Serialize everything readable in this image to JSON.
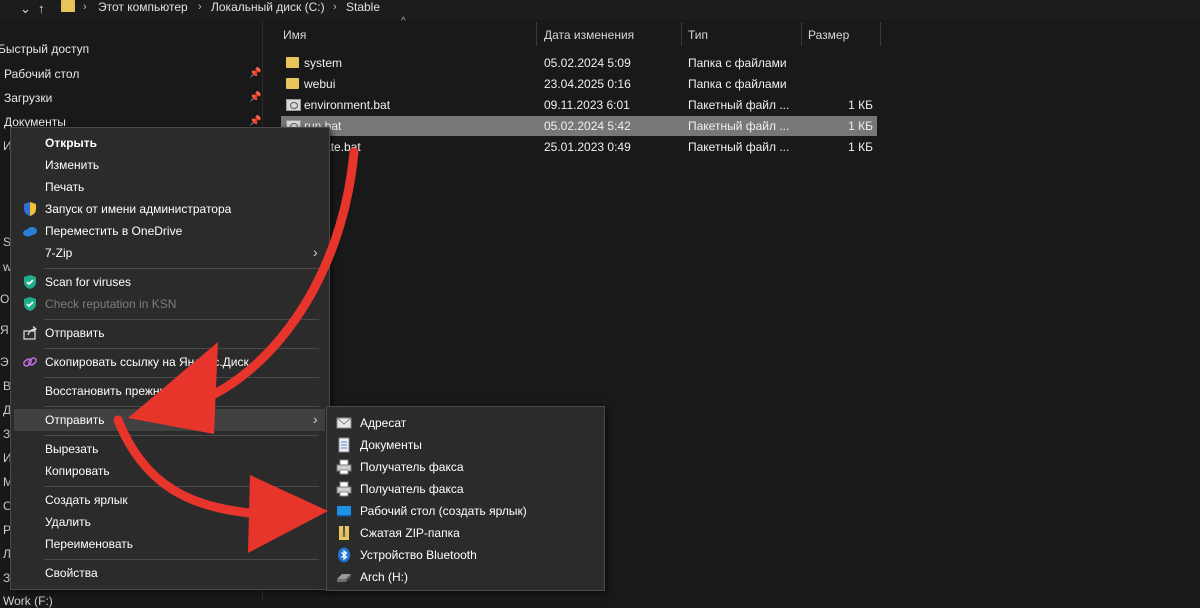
{
  "addressbar": {
    "back_icon": "chevron-down-icon",
    "up_icon": "up-arrow-icon",
    "crumbs": [
      "Этот компьютер",
      "Локальный диск (C:)",
      "Stable"
    ]
  },
  "sidebar": {
    "items": [
      {
        "label": "Быстрый доступ"
      },
      {
        "label": "Рабочий стол",
        "pinned": true
      },
      {
        "label": "Загрузки",
        "pinned": true
      },
      {
        "label": "Документы",
        "pinned": true
      }
    ],
    "fragments": [
      "И",
      "S",
      "w",
      "O",
      "Я",
      "Э",
      "В",
      "Д",
      "З",
      "И",
      "M",
      "O",
      "P",
      "Л",
      "З",
      "Work (F:)"
    ]
  },
  "filelist": {
    "columns": [
      "Имя",
      "Дата изменения",
      "Тип",
      "Размер"
    ],
    "rows": [
      {
        "name": "system",
        "date": "05.02.2024 5:09",
        "type": "Папка с файлами",
        "size": "",
        "icon": "folder-icon"
      },
      {
        "name": "webui",
        "date": "23.04.2025 0:16",
        "type": "Папка с файлами",
        "size": "",
        "icon": "folder-icon"
      },
      {
        "name": "environment.bat",
        "date": "09.11.2023 6:01",
        "type": "Пакетный файл ...",
        "size": "1 КБ",
        "icon": "batch-file-icon"
      },
      {
        "name": "run.bat",
        "date": "05.02.2024 5:42",
        "type": "Пакетный файл ...",
        "size": "1 КБ",
        "icon": "batch-file-icon",
        "selected": true
      },
      {
        "name": "update.bat",
        "date": "25.01.2023 0:49",
        "type": "Пакетный файл ...",
        "size": "1 КБ",
        "icon": "batch-file-icon"
      }
    ]
  },
  "context_menu": {
    "items": [
      {
        "label": "Открыть",
        "bold": true
      },
      {
        "label": "Изменить"
      },
      {
        "label": "Печать"
      },
      {
        "label": "Запуск от имени администратора",
        "icon": "shield-icon"
      },
      {
        "label": "Переместить в OneDrive",
        "icon": "cloud-icon"
      },
      {
        "label": "7-Zip",
        "submenu": true
      },
      {
        "label": "Scan for viruses",
        "icon": "kaspersky-icon"
      },
      {
        "label": "Check reputation in KSN",
        "icon": "kaspersky-icon",
        "disabled": true
      },
      {
        "label": "Отправить",
        "icon": "share-icon"
      },
      {
        "label": "Скопировать ссылку на Яндекс.Диск",
        "icon": "link-icon"
      },
      {
        "label": "Восстановить прежнюю версию"
      },
      {
        "label": "Отправить",
        "submenu": true,
        "highlighted": true
      },
      {
        "label": "Вырезать"
      },
      {
        "label": "Копировать"
      },
      {
        "label": "Создать ярлык"
      },
      {
        "label": "Удалить"
      },
      {
        "label": "Переименовать"
      },
      {
        "label": "Свойства"
      }
    ]
  },
  "send_to_menu": {
    "items": [
      {
        "label": "Адресат",
        "icon": "mail-recipient-icon"
      },
      {
        "label": "Документы",
        "icon": "documents-icon"
      },
      {
        "label": "Получатель факса",
        "icon": "fax-icon"
      },
      {
        "label": "Получатель факса",
        "icon": "fax-icon"
      },
      {
        "label": "Рабочий стол (создать ярлык)",
        "icon": "desktop-icon"
      },
      {
        "label": "Сжатая ZIP-папка",
        "icon": "zip-folder-icon"
      },
      {
        "label": "Устройство Bluetooth",
        "icon": "bluetooth-icon"
      },
      {
        "label": "Arch (H:)",
        "icon": "drive-icon"
      }
    ]
  },
  "colors": {
    "background": "#191919",
    "menu_background": "#2b2b2b",
    "selection": "#777777",
    "annotation_arrow": "#e8352b",
    "folder": "#e8c55a"
  }
}
